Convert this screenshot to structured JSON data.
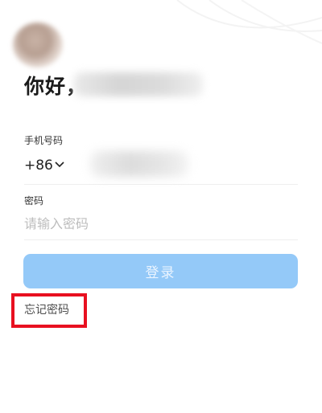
{
  "header": {
    "avatar_icon": "user-avatar",
    "greeting": "你好，"
  },
  "form": {
    "phone_label": "手机号码",
    "country_code": "+86",
    "password_label": "密码",
    "password_placeholder": "请输入密码",
    "login_label": "登录",
    "forgot_password": "忘记密码"
  },
  "colors": {
    "login_button": "#94c9f8",
    "highlight_box": "#e81020"
  }
}
